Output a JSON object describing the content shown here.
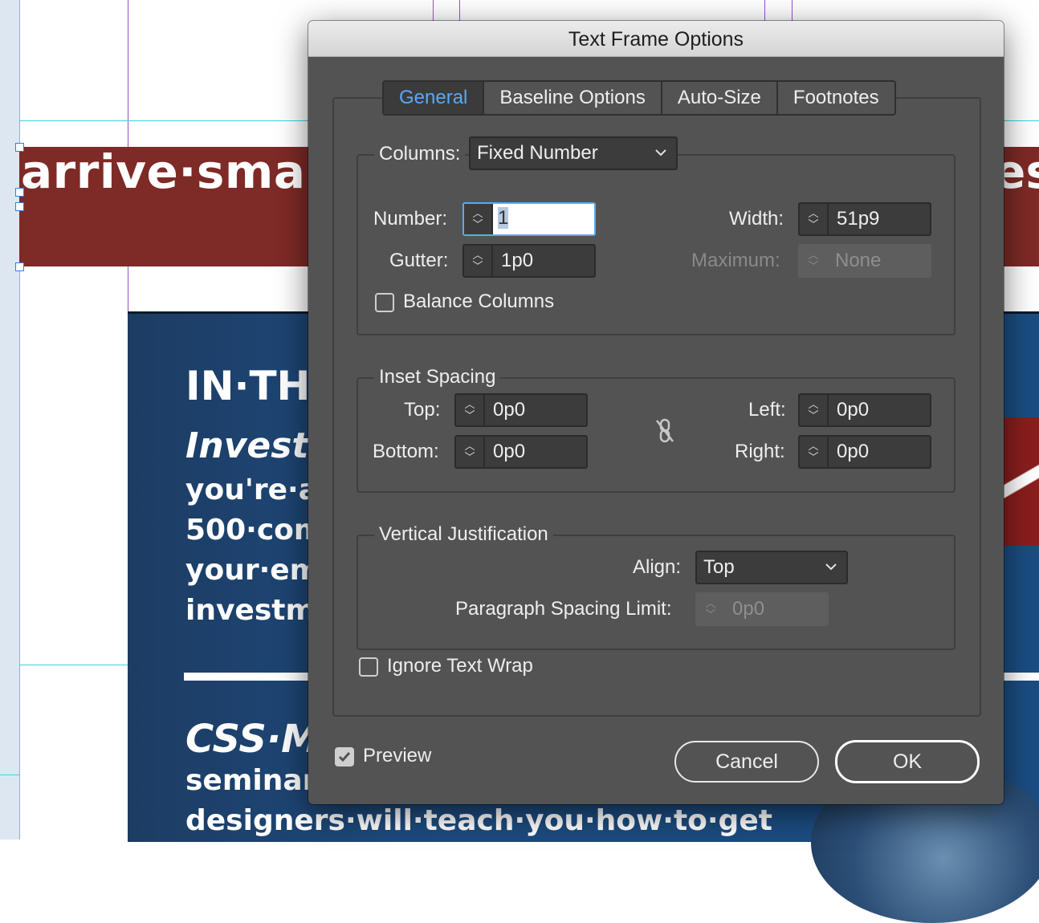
{
  "document": {
    "band_headline": "arrive·smart",
    "band_headline_right": "es",
    "line1": "IN·THIS",
    "line2": "Investi",
    "line3": "you're·a",
    "line4": "500·com",
    "line5": "your·em",
    "line6": "investm",
    "line7": "CSS·M",
    "line8": "seminar",
    "line9": "designers·will·teach·you·how·to·get"
  },
  "dialog": {
    "title": "Text Frame Options",
    "tabs": [
      {
        "label": "General",
        "active": true
      },
      {
        "label": "Baseline Options",
        "active": false
      },
      {
        "label": "Auto-Size",
        "active": false
      },
      {
        "label": "Footnotes",
        "active": false
      }
    ],
    "columns": {
      "label": "Columns:",
      "mode": "Fixed Number",
      "number_label": "Number:",
      "number_value": "1",
      "gutter_label": "Gutter:",
      "gutter_value": "1p0",
      "width_label": "Width:",
      "width_value": "51p9",
      "maximum_label": "Maximum:",
      "maximum_value": "None",
      "balance_label": "Balance Columns",
      "balance_checked": false
    },
    "inset": {
      "title": "Inset Spacing",
      "top_label": "Top:",
      "top_value": "0p0",
      "bottom_label": "Bottom:",
      "bottom_value": "0p0",
      "left_label": "Left:",
      "left_value": "0p0",
      "right_label": "Right:",
      "right_value": "0p0"
    },
    "vertical": {
      "title": "Vertical Justification",
      "align_label": "Align:",
      "align_value": "Top",
      "psl_label": "Paragraph Spacing Limit:",
      "psl_value": "0p0"
    },
    "ignore_wrap_label": "Ignore Text Wrap",
    "ignore_wrap_checked": false,
    "preview_label": "Preview",
    "preview_checked": true,
    "cancel_label": "Cancel",
    "ok_label": "OK",
    "colors": {
      "dialog_bg": "#535353",
      "accent": "#5aa9f2"
    }
  }
}
